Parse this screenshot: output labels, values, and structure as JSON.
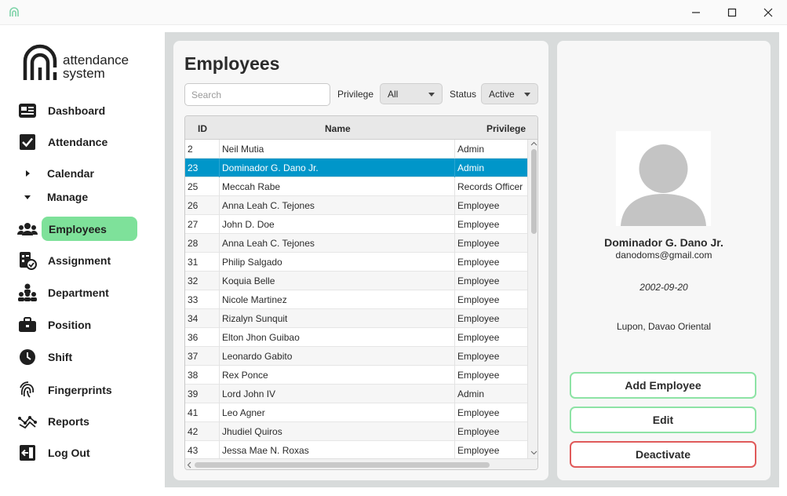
{
  "window": {
    "controls": {
      "minimize": "minimize-icon",
      "maximize": "maximize-icon",
      "close": "close-icon"
    }
  },
  "sidebar": {
    "logo": {
      "line1": "attendance",
      "line2": "system"
    },
    "items": [
      {
        "label": "Dashboard",
        "icon": "dashboard-icon"
      },
      {
        "label": "Attendance",
        "icon": "checkbox-icon"
      },
      {
        "label": "Calendar",
        "icon": "triangle-right-icon"
      },
      {
        "label": "Manage",
        "icon": "triangle-down-icon"
      },
      {
        "label": "Employees",
        "icon": "users-icon",
        "active": true
      },
      {
        "label": "Assignment",
        "icon": "assignment-icon"
      },
      {
        "label": "Department",
        "icon": "department-icon"
      },
      {
        "label": "Position",
        "icon": "briefcase-icon"
      },
      {
        "label": "Shift",
        "icon": "clock-icon"
      },
      {
        "label": "Fingerprints",
        "icon": "fingerprint-icon"
      },
      {
        "label": "Reports",
        "icon": "reports-icon"
      },
      {
        "label": "Log Out",
        "icon": "logout-icon"
      }
    ]
  },
  "employees": {
    "title": "Employees",
    "search_placeholder": "Search",
    "privilege_label": "Privilege",
    "privilege_value": "All",
    "status_label": "Status",
    "status_value": "Active",
    "columns": {
      "id": "ID",
      "name": "Name",
      "privilege": "Privilege"
    },
    "rows": [
      {
        "id": "2",
        "name": "Neil Mutia",
        "privilege": "Admin"
      },
      {
        "id": "23",
        "name": "Dominador G. Dano Jr.",
        "privilege": "Admin",
        "selected": true
      },
      {
        "id": "25",
        "name": "Meccah Rabe",
        "privilege": "Records Officer"
      },
      {
        "id": "26",
        "name": "Anna Leah C. Tejones",
        "privilege": "Employee"
      },
      {
        "id": "27",
        "name": "John D. Doe",
        "privilege": "Employee"
      },
      {
        "id": "28",
        "name": "Anna Leah C. Tejones",
        "privilege": "Employee"
      },
      {
        "id": "31",
        "name": "Philip Salgado",
        "privilege": "Employee"
      },
      {
        "id": "32",
        "name": "Koquia Belle",
        "privilege": "Employee"
      },
      {
        "id": "33",
        "name": "Nicole Martinez",
        "privilege": "Employee"
      },
      {
        "id": "34",
        "name": "Rizalyn Sunquit",
        "privilege": "Employee"
      },
      {
        "id": "36",
        "name": "Elton Jhon Guibao",
        "privilege": "Employee"
      },
      {
        "id": "37",
        "name": "Leonardo Gabito",
        "privilege": "Employee"
      },
      {
        "id": "38",
        "name": "Rex Ponce",
        "privilege": "Employee"
      },
      {
        "id": "39",
        "name": "Lord John IV",
        "privilege": "Admin"
      },
      {
        "id": "41",
        "name": "Leo Agner",
        "privilege": "Employee"
      },
      {
        "id": "42",
        "name": "Jhudiel Quiros",
        "privilege": "Employee"
      },
      {
        "id": "43",
        "name": "Jessa Mae N. Roxas",
        "privilege": "Employee"
      }
    ]
  },
  "details": {
    "name": "Dominador G. Dano Jr.",
    "email": "danodoms@gmail.com",
    "birthdate": "2002-09-20",
    "address": "Lupon, Davao Oriental",
    "buttons": {
      "add": "Add Employee",
      "edit": "Edit",
      "deactivate": "Deactivate"
    }
  },
  "colors": {
    "accent_green": "#7ee19a",
    "selection_blue": "#0096c9",
    "danger_red": "#e05a5a"
  }
}
